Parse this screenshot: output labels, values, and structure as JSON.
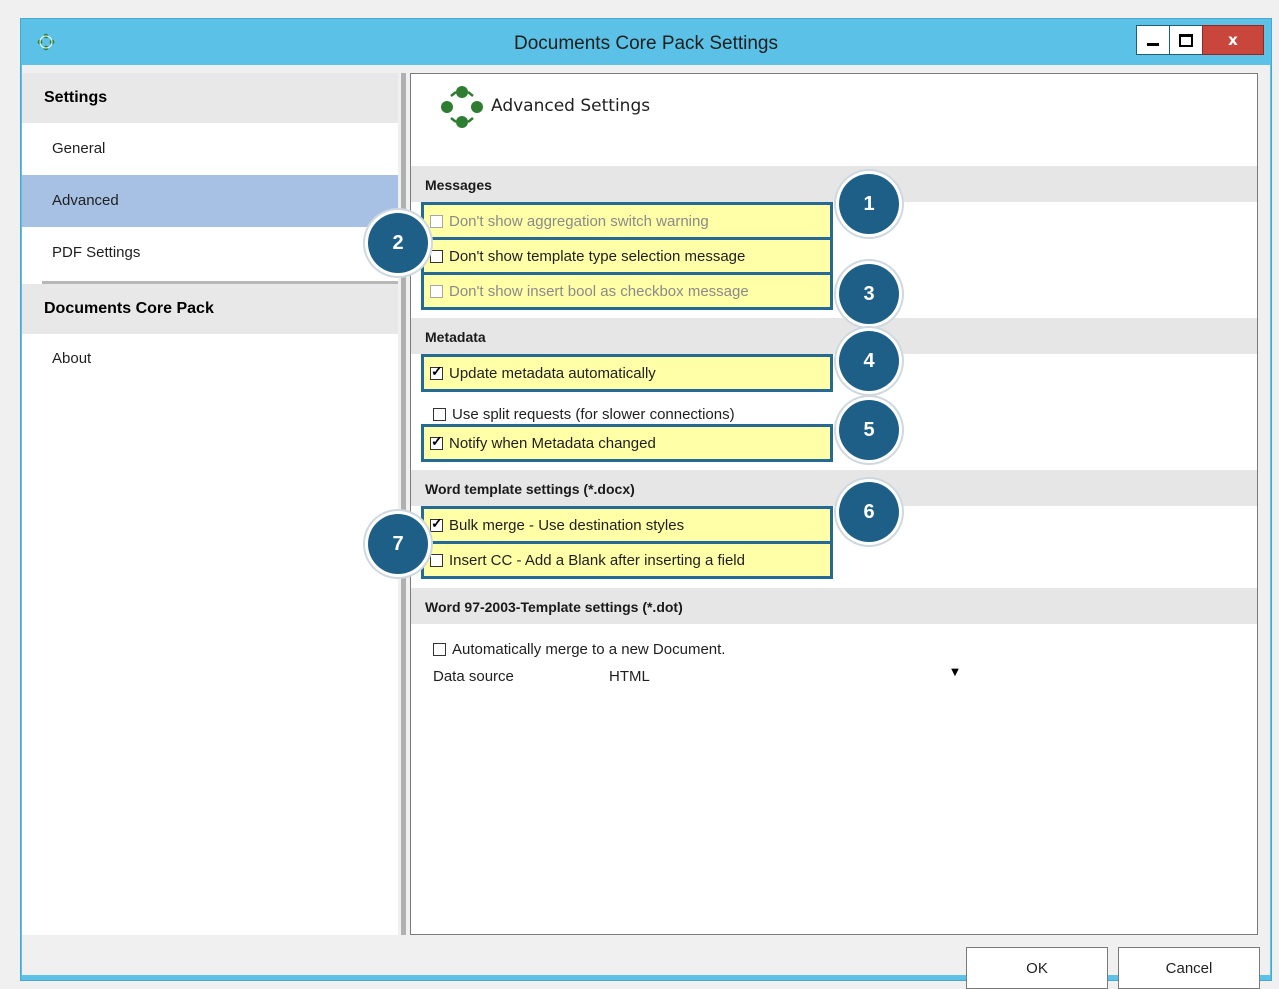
{
  "window": {
    "title": "Documents Core Pack Settings",
    "close_label": "x"
  },
  "sidebar": {
    "sections": [
      {
        "header": "Settings",
        "items": [
          "General",
          "Advanced",
          "PDF Settings"
        ]
      },
      {
        "header": "Documents Core Pack",
        "items": [
          "About"
        ]
      }
    ],
    "selected": "Advanced"
  },
  "panel": {
    "title": "Advanced Settings",
    "sections": {
      "messages": "Messages",
      "metadata": "Metadata",
      "word_docx": "Word template settings (*.docx)",
      "word_dot": "Word 97-2003-Template settings (*.dot)"
    },
    "options": {
      "aggregation_warning": {
        "label": "Don't show aggregation switch warning",
        "checked": false,
        "enabled": false
      },
      "template_type_message": {
        "label": "Don't show template type selection message",
        "checked": false,
        "enabled": true
      },
      "insert_bool_message": {
        "label": "Don't show insert bool as checkbox message",
        "checked": false,
        "enabled": false
      },
      "update_metadata": {
        "label": "Update metadata automatically",
        "checked": true,
        "enabled": true
      },
      "split_requests": {
        "label": "Use split requests (for slower connections)",
        "checked": false,
        "enabled": true
      },
      "notify_metadata": {
        "label": "Notify when Metadata changed",
        "checked": true,
        "enabled": true
      },
      "bulk_merge": {
        "label": "Bulk merge - Use destination styles",
        "checked": true,
        "enabled": true
      },
      "insert_cc": {
        "label": "Insert CC - Add a Blank after inserting a field",
        "checked": false,
        "enabled": true
      },
      "auto_merge": {
        "label": "Automatically merge to a new Document.",
        "checked": false,
        "enabled": true
      }
    },
    "data_source": {
      "label": "Data source",
      "value": "HTML"
    }
  },
  "callouts": [
    "1",
    "2",
    "3",
    "4",
    "5",
    "6",
    "7"
  ],
  "footer": {
    "ok": "OK",
    "cancel": "Cancel"
  },
  "colors": {
    "title_bar": "#5bc1e6",
    "selected_item": "#a7c1e5",
    "highlight": "#ffffa8",
    "callout": "#1e5f88",
    "close_button": "#c9463d"
  }
}
